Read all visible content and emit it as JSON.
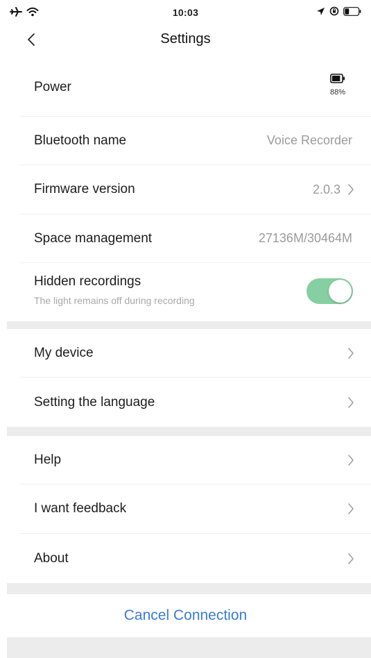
{
  "status_bar": {
    "time": "10:03",
    "left_icons": [
      "airplane-icon",
      "wifi-icon"
    ],
    "right_icons": [
      "location-arrow-icon",
      "rotation-lock-icon",
      "battery-icon"
    ]
  },
  "nav": {
    "back_glyph": "<",
    "title": "Settings"
  },
  "device_section": {
    "power": {
      "label": "Power",
      "battery_percent": "88%",
      "battery_level": 0.88
    },
    "bluetooth": {
      "label": "Bluetooth name",
      "value": "Voice Recorder"
    },
    "firmware": {
      "label": "Firmware version",
      "value": "2.0.3"
    },
    "space": {
      "label": "Space management",
      "value": "27136M/30464M"
    },
    "hidden_recordings": {
      "label": "Hidden recordings",
      "description": "The light remains off during recording",
      "enabled": true
    }
  },
  "general_section": {
    "items": [
      {
        "label": "My device"
      },
      {
        "label": "Setting the language"
      }
    ]
  },
  "support_section": {
    "items": [
      {
        "label": "Help"
      },
      {
        "label": "I want feedback"
      },
      {
        "label": "About"
      }
    ]
  },
  "cancel_connection": {
    "label": "Cancel Connection"
  },
  "colors": {
    "toggle_on": "#86cfa2",
    "link_blue": "#3b7bd4",
    "section_gap": "#ececec",
    "secondary_text": "#9b9b9b"
  }
}
